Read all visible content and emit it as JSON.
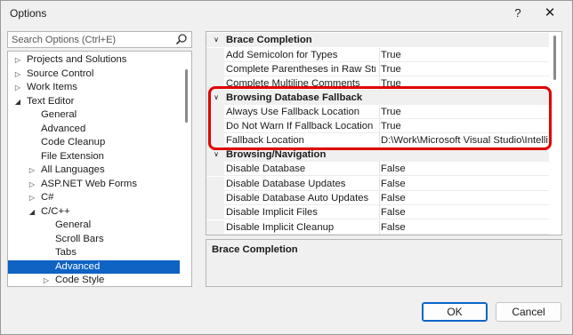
{
  "window": {
    "title": "Options",
    "help_label": "?",
    "close_label": "✕"
  },
  "search": {
    "placeholder": "Search Options (Ctrl+E)"
  },
  "tree": [
    {
      "label": "Projects and Solutions",
      "expander": "▷",
      "depth": 0
    },
    {
      "label": "Source Control",
      "expander": "▷",
      "depth": 0
    },
    {
      "label": "Work Items",
      "expander": "▷",
      "depth": 0
    },
    {
      "label": "Text Editor",
      "expander": "◢",
      "depth": 0
    },
    {
      "label": "General",
      "expander": "",
      "depth": 1
    },
    {
      "label": "Advanced",
      "expander": "",
      "depth": 1
    },
    {
      "label": "Code Cleanup",
      "expander": "",
      "depth": 1
    },
    {
      "label": "File Extension",
      "expander": "",
      "depth": 1
    },
    {
      "label": "All Languages",
      "expander": "▷",
      "depth": 1
    },
    {
      "label": "ASP.NET Web Forms",
      "expander": "▷",
      "depth": 1
    },
    {
      "label": "C#",
      "expander": "▷",
      "depth": 1
    },
    {
      "label": "C/C++",
      "expander": "◢",
      "depth": 1
    },
    {
      "label": "General",
      "expander": "",
      "depth": 2
    },
    {
      "label": "Scroll Bars",
      "expander": "",
      "depth": 2
    },
    {
      "label": "Tabs",
      "expander": "",
      "depth": 2
    },
    {
      "label": "Advanced",
      "expander": "",
      "depth": 2,
      "selected": true
    },
    {
      "label": "Code Style",
      "expander": "▷",
      "depth": 2
    }
  ],
  "grid": [
    {
      "type": "category",
      "label": "Brace Completion",
      "expander": "∨"
    },
    {
      "type": "property",
      "name": "Add Semicolon for Types",
      "value": "True"
    },
    {
      "type": "property",
      "name": "Complete Parentheses in Raw String I",
      "value": "True"
    },
    {
      "type": "property",
      "name": "Complete Multiline Comments",
      "value": "True"
    },
    {
      "type": "category",
      "label": "Browsing Database Fallback",
      "expander": "∨"
    },
    {
      "type": "property",
      "name": "Always Use Fallback Location",
      "value": "True"
    },
    {
      "type": "property",
      "name": "Do Not Warn If Fallback Location Use",
      "value": "True"
    },
    {
      "type": "property",
      "name": "Fallback Location",
      "value": "D:\\Work\\Microsoft Visual Studio\\IntelliSe"
    },
    {
      "type": "category",
      "label": "Browsing/Navigation",
      "expander": "∨"
    },
    {
      "type": "property",
      "name": "Disable Database",
      "value": "False"
    },
    {
      "type": "property",
      "name": "Disable Database Updates",
      "value": "False"
    },
    {
      "type": "property",
      "name": "Disable Database Auto Updates",
      "value": "False"
    },
    {
      "type": "property",
      "name": "Disable Implicit Files",
      "value": "False"
    },
    {
      "type": "property",
      "name": "Disable Implicit Cleanup",
      "value": "False"
    }
  ],
  "description": {
    "title": "Brace Completion"
  },
  "buttons": {
    "ok": "OK",
    "cancel": "Cancel"
  },
  "colors": {
    "selection": "#0e63c3",
    "highlight_box": "#e00000",
    "ok_border": "#0a64c8"
  },
  "icons": {
    "search": "magnifier-icon",
    "help": "question-mark-icon",
    "close": "close-x-icon"
  }
}
